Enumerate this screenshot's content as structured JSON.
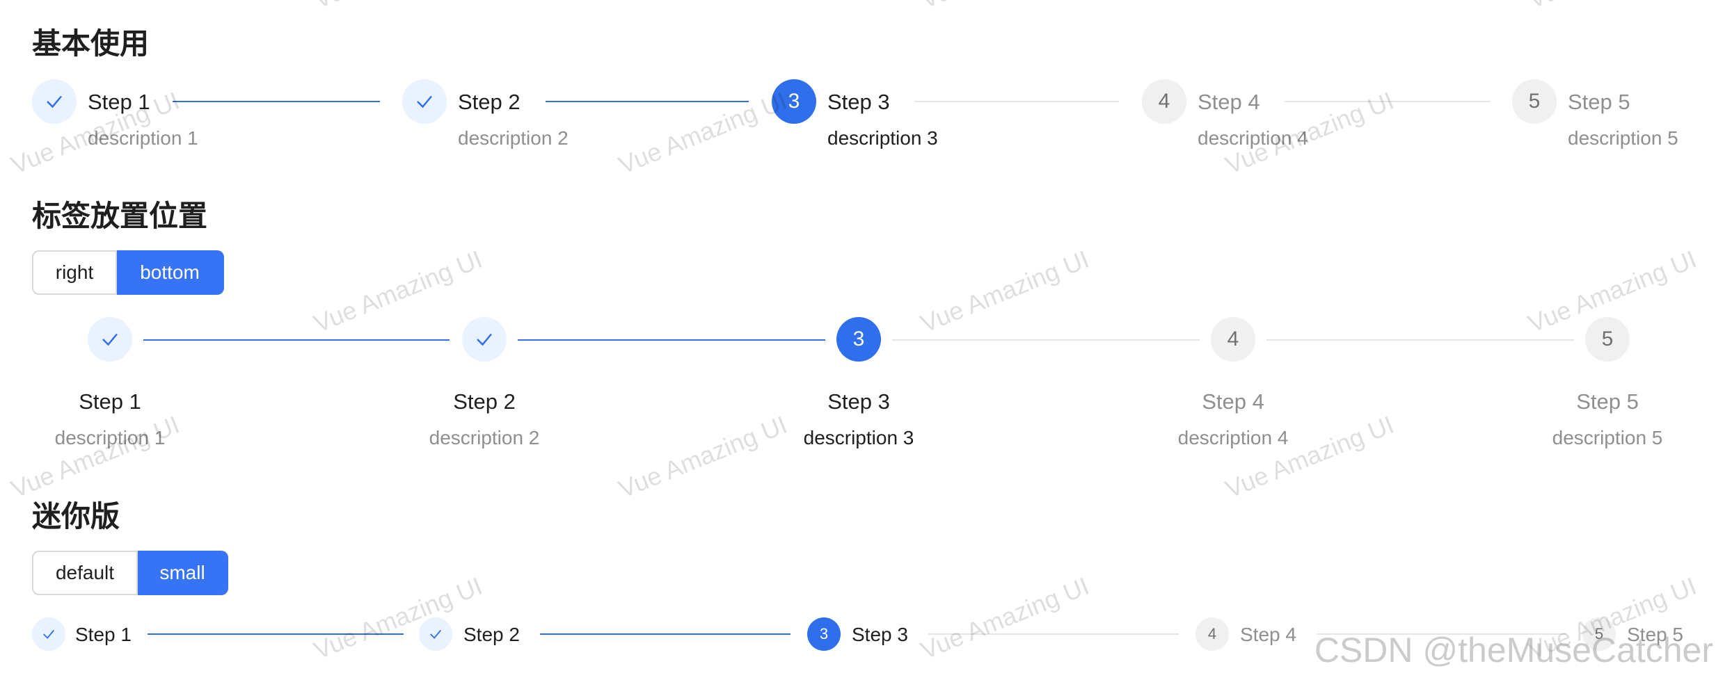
{
  "sections": {
    "basic": {
      "heading": "基本使用"
    },
    "placement": {
      "heading": "标签放置位置",
      "options": [
        "right",
        "bottom"
      ],
      "selected": "bottom"
    },
    "mini": {
      "heading": "迷你版",
      "options": [
        "default",
        "small"
      ],
      "selected": "small"
    }
  },
  "steps": [
    {
      "index": "1",
      "title": "Step 1",
      "description": "description 1",
      "status": "finish"
    },
    {
      "index": "2",
      "title": "Step 2",
      "description": "description 2",
      "status": "finish"
    },
    {
      "index": "3",
      "title": "Step 3",
      "description": "description 3",
      "status": "process"
    },
    {
      "index": "4",
      "title": "Step 4",
      "description": "description 4",
      "status": "wait"
    },
    {
      "index": "5",
      "title": "Step 5",
      "description": "description 5",
      "status": "wait"
    }
  ],
  "current_step": 3,
  "watermark": "Vue Amazing UI",
  "footer_watermark": "CSDN @theMuseCatcher",
  "icons": {
    "finish": "check-icon"
  },
  "colors": {
    "primary": "#2f6feb",
    "finish_bg": "#e9f2ff",
    "wait_bg": "#f0f0f0",
    "line_wait": "#e6e6e6"
  }
}
